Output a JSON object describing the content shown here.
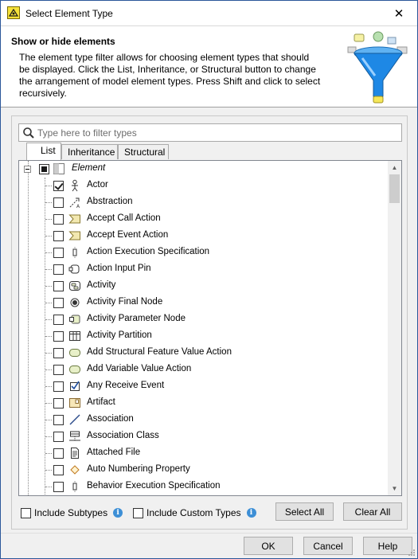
{
  "window": {
    "title": "Select Element Type",
    "close_glyph": "✕"
  },
  "header": {
    "title": "Show or hide elements",
    "description": "The element type filter allows for choosing element types that should be displayed. Click the List, Inheritance, or Structural button to change the arrangement of model element types. Press Shift and click to select recursively."
  },
  "filter": {
    "placeholder": "Type here to filter types",
    "value": ""
  },
  "tabs": [
    {
      "label": "List",
      "active": true
    },
    {
      "label": "Inheritance",
      "active": false
    },
    {
      "label": "Structural",
      "active": false
    }
  ],
  "tree": {
    "root": {
      "label": "Element",
      "state": "mixed",
      "expanded": true
    },
    "items": [
      {
        "label": "Actor",
        "checked": true,
        "icon": "actor-icon"
      },
      {
        "label": "Abstraction",
        "checked": false,
        "icon": "abstraction-icon"
      },
      {
        "label": "Accept Call Action",
        "checked": false,
        "icon": "accept-call-action-icon"
      },
      {
        "label": "Accept Event Action",
        "checked": false,
        "icon": "accept-event-action-icon"
      },
      {
        "label": "Action Execution Specification",
        "checked": false,
        "icon": "action-execution-specification-icon"
      },
      {
        "label": "Action Input Pin",
        "checked": false,
        "icon": "action-input-pin-icon"
      },
      {
        "label": "Activity",
        "checked": false,
        "icon": "activity-icon"
      },
      {
        "label": "Activity Final Node",
        "checked": false,
        "icon": "activity-final-node-icon"
      },
      {
        "label": "Activity Parameter Node",
        "checked": false,
        "icon": "activity-parameter-node-icon"
      },
      {
        "label": "Activity Partition",
        "checked": false,
        "icon": "activity-partition-icon"
      },
      {
        "label": "Add Structural Feature Value Action",
        "checked": false,
        "icon": "action-icon"
      },
      {
        "label": "Add Variable Value Action",
        "checked": false,
        "icon": "action-icon"
      },
      {
        "label": "Any Receive Event",
        "checked": false,
        "icon": "any-receive-event-icon"
      },
      {
        "label": "Artifact",
        "checked": false,
        "icon": "artifact-icon"
      },
      {
        "label": "Association",
        "checked": false,
        "icon": "association-icon"
      },
      {
        "label": "Association Class",
        "checked": false,
        "icon": "association-class-icon"
      },
      {
        "label": "Attached File",
        "checked": false,
        "icon": "attached-file-icon"
      },
      {
        "label": "Auto Numbering Property",
        "checked": false,
        "icon": "auto-numbering-property-icon"
      },
      {
        "label": "Behavior Execution Specification",
        "checked": false,
        "icon": "behavior-execution-specification-icon"
      }
    ]
  },
  "options": {
    "include_subtypes": "Include Subtypes",
    "include_custom_types": "Include Custom Types",
    "info_glyph": "i"
  },
  "buttons": {
    "select_all": "Select All",
    "clear_all": "Clear All",
    "ok": "OK",
    "cancel": "Cancel",
    "help": "Help"
  },
  "colors": {
    "accent": "#2b579a",
    "info": "#3d8fd6",
    "funnel": "#1e88e5"
  }
}
